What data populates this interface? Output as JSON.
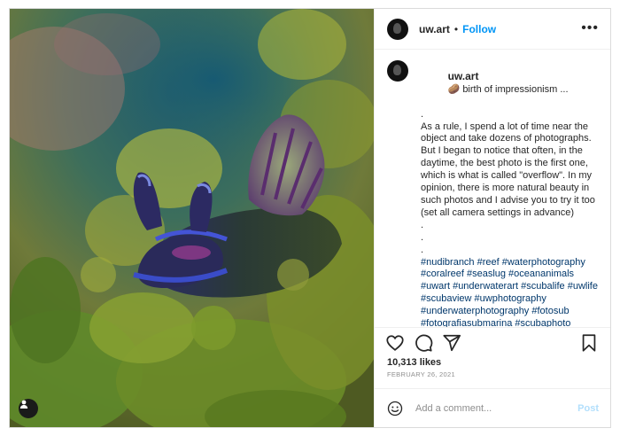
{
  "header": {
    "username": "uw.art",
    "separator": "•",
    "follow_label": "Follow",
    "more_label": "•••"
  },
  "caption": {
    "username": "uw.art",
    "headline": "🥔 birth of impressionism ...",
    "spacer1": ".",
    "body": "As a rule, I spend a lot of time near the object and take dozens of photographs. But I began to notice that often, in the daytime, the best photo is the first one, which is what is called \"overflow\". In my opinion, there is more natural beauty in such photos and I advise you to try it too (set all camera settings in advance)",
    "spacer2": ".",
    "spacer3": ".",
    "spacer4": ".",
    "hashtags": "#nudibranch #reef #waterphotography #coralreef #seaslug #oceananimals #uwart #underwaterart #scubalife #uwlife #scubaview #uwphotography #underwaterphotography #fotosub #fotografiasubmarina #scubaphoto"
  },
  "actions": {
    "like_icon": "heart-icon",
    "comment_icon": "comment-icon",
    "share_icon": "paper-plane-icon",
    "save_icon": "bookmark-icon"
  },
  "likes": "10,313 likes",
  "date": "FEBRUARY 26, 2021",
  "comment_box": {
    "placeholder": "Add a comment...",
    "post_label": "Post"
  },
  "colors": {
    "accent": "#0095f6",
    "post_disabled": "#b2dffc",
    "hashtag": "#00376b"
  }
}
